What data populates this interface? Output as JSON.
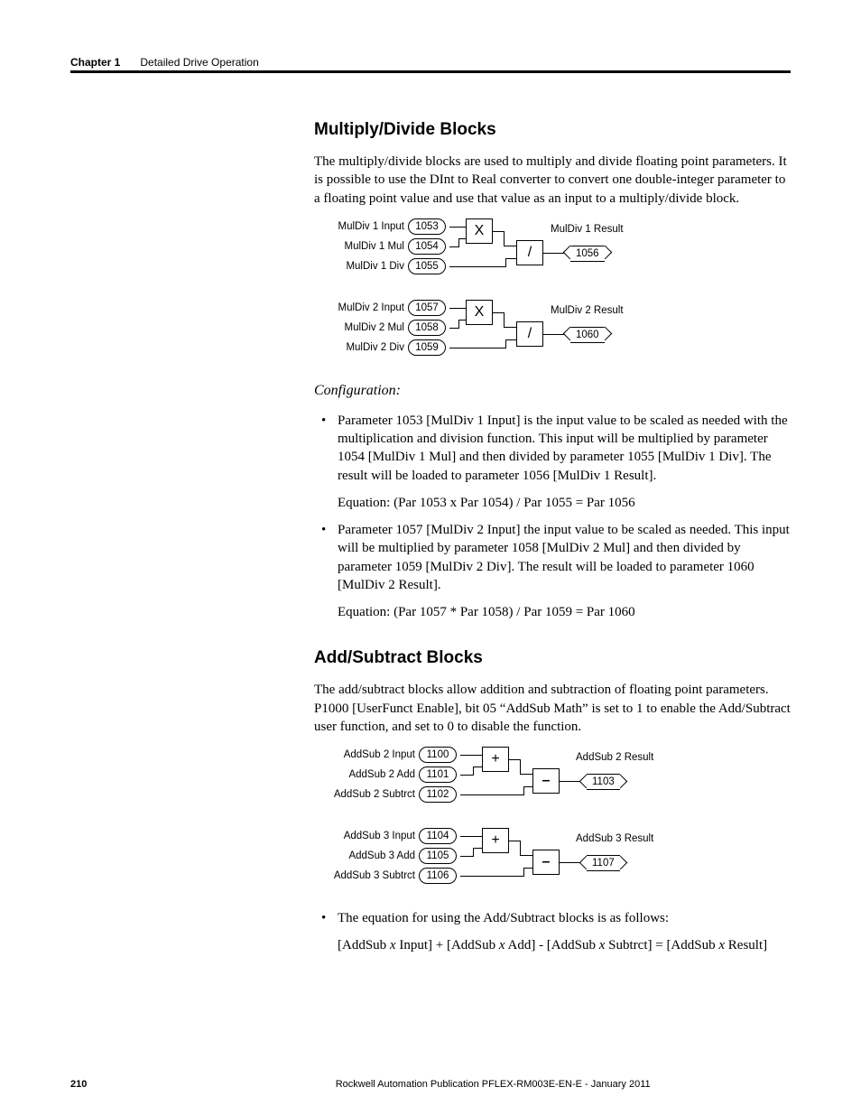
{
  "header": {
    "chapter": "Chapter 1",
    "title": "Detailed Drive Operation"
  },
  "section1": {
    "heading": "Multiply/Divide Blocks",
    "intro": "The multiply/divide blocks are used to multiply and divide floating point parameters. It is possible to use the DInt to Real converter to convert one double-integer parameter to a floating point value and use that value as an input to a multiply/divide block.",
    "config_label": "Configuration:",
    "bullets": [
      {
        "text": "Parameter 1053 [MulDiv 1 Input] is the input value to be scaled as needed with the multiplication and division function. This input will be multiplied by parameter 1054 [MulDiv 1 Mul] and then divided by parameter 1055 [MulDiv 1 Div]. The result will be loaded to parameter 1056 [MulDiv 1 Result].",
        "equation": "Equation: (Par 1053 x Par 1054) / Par 1055 = Par 1056"
      },
      {
        "text": "Parameter 1057 [MulDiv 2 Input] the input value to be scaled as needed. This input will be multiplied by parameter 1058 [MulDiv 2 Mul] and then divided by parameter 1059 [MulDiv 2 Div]. The result will be loaded to parameter 1060 [MulDiv 2 Result].",
        "equation": "Equation: (Par 1057 * Par 1058) / Par 1059 = Par 1060"
      }
    ],
    "blocks": [
      {
        "inputs": [
          {
            "label": "MulDiv 1 Input",
            "param": "1053"
          },
          {
            "label": "MulDiv 1 Mul",
            "param": "1054"
          },
          {
            "label": "MulDiv 1 Div",
            "param": "1055"
          }
        ],
        "op1": "X",
        "op2": "/",
        "result_label": "MulDiv 1 Result",
        "result_param": "1056"
      },
      {
        "inputs": [
          {
            "label": "MulDiv 2 Input",
            "param": "1057"
          },
          {
            "label": "MulDiv 2 Mul",
            "param": "1058"
          },
          {
            "label": "MulDiv 2 Div",
            "param": "1059"
          }
        ],
        "op1": "X",
        "op2": "/",
        "result_label": "MulDiv 2 Result",
        "result_param": "1060"
      }
    ]
  },
  "section2": {
    "heading": "Add/Subtract Blocks",
    "intro": "The add/subtract blocks allow addition and subtraction of floating point parameters. P1000 [UserFunct Enable], bit 05 “AddSub Math” is set to 1 to enable the Add/Subtract user function, and set to 0 to disable the function.",
    "blocks": [
      {
        "inputs": [
          {
            "label": "AddSub 2 Input",
            "param": "1100"
          },
          {
            "label": "AddSub 2 Add",
            "param": "1101"
          },
          {
            "label": "AddSub 2 Subtrct",
            "param": "1102"
          }
        ],
        "op1": "+",
        "op2": "–",
        "result_label": "AddSub 2 Result",
        "result_param": "1103"
      },
      {
        "inputs": [
          {
            "label": "AddSub 3 Input",
            "param": "1104"
          },
          {
            "label": "AddSub 3 Add",
            "param": "1105"
          },
          {
            "label": "AddSub 3 Subtrct",
            "param": "1106"
          }
        ],
        "op1": "+",
        "op2": "–",
        "result_label": "AddSub 3 Result",
        "result_param": "1107"
      }
    ],
    "bullet": "The equation for using the Add/Subtract blocks is as follows:",
    "equation_plain": "[AddSub x Input] + [AddSub x Add] - [AddSub x Subtrct] = [AddSub x Result]"
  },
  "footer": {
    "page": "210",
    "pub": "Rockwell Automation Publication PFLEX-RM003E-EN-E - January 2011"
  }
}
